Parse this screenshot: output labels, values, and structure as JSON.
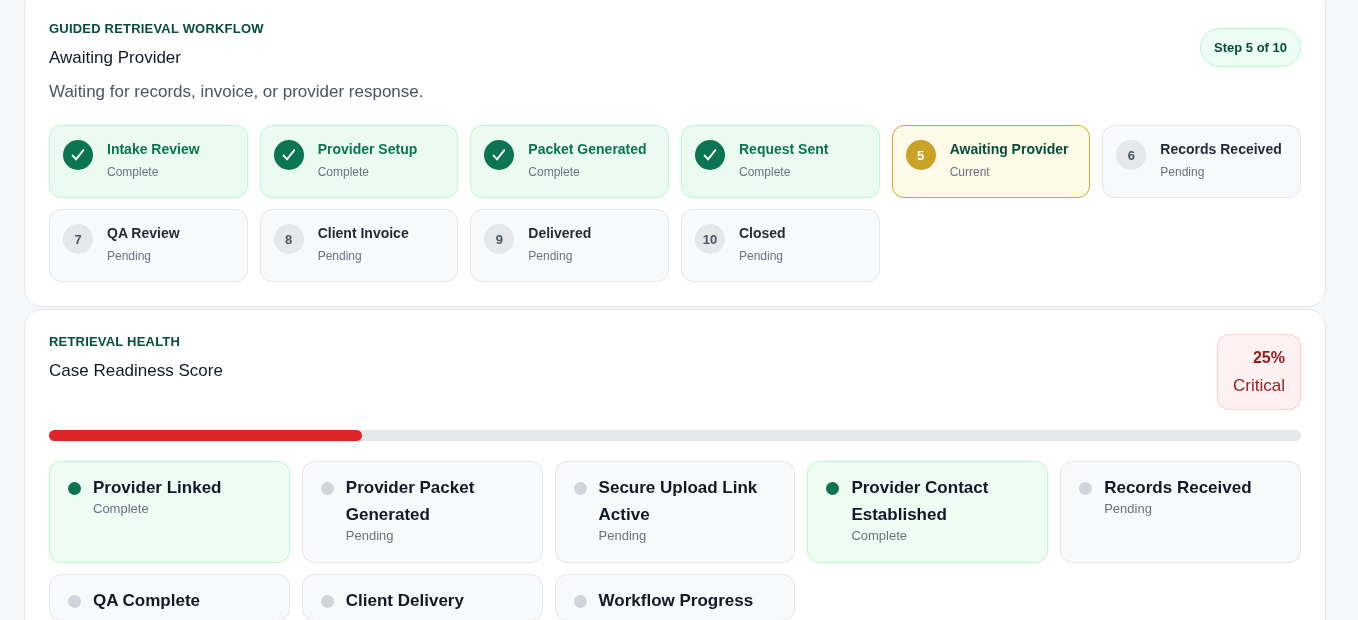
{
  "workflow": {
    "eyebrow": "GUIDED RETRIEVAL WORKFLOW",
    "title": "Awaiting Provider",
    "description": "Waiting for records, invoice, or provider response.",
    "step_badge": "Step 5 of 10",
    "steps": [
      {
        "label": "Intake Review",
        "status": "Complete",
        "kind": "complete"
      },
      {
        "label": "Provider Setup",
        "status": "Complete",
        "kind": "complete"
      },
      {
        "label": "Packet Generated",
        "status": "Complete",
        "kind": "complete"
      },
      {
        "label": "Request Sent",
        "status": "Complete",
        "kind": "complete"
      },
      {
        "number": "5",
        "label": "Awaiting Provider",
        "status": "Current",
        "kind": "current"
      },
      {
        "number": "6",
        "label": "Records Received",
        "status": "Pending",
        "kind": "pending"
      },
      {
        "number": "7",
        "label": "QA Review",
        "status": "Pending",
        "kind": "pending"
      },
      {
        "number": "8",
        "label": "Client Invoice",
        "status": "Pending",
        "kind": "pending"
      },
      {
        "number": "9",
        "label": "Delivered",
        "status": "Pending",
        "kind": "pending"
      },
      {
        "number": "10",
        "label": "Closed",
        "status": "Pending",
        "kind": "pending"
      }
    ]
  },
  "health": {
    "eyebrow": "RETRIEVAL HEALTH",
    "title": "Case Readiness Score",
    "score": "25%",
    "rating": "Critical",
    "level": 0.25,
    "checks": [
      {
        "label": "Provider Linked",
        "status": "Complete",
        "complete": true
      },
      {
        "label": "Provider Packet Generated",
        "status": "Pending",
        "complete": false
      },
      {
        "label": "Secure Upload Link Active",
        "status": "Pending",
        "complete": false
      },
      {
        "label": "Provider Contact Established",
        "status": "Complete",
        "complete": true
      },
      {
        "label": "Records Received",
        "status": "Pending",
        "complete": false
      },
      {
        "label": "QA Complete",
        "complete": false
      },
      {
        "label": "Client Delivery",
        "complete": false
      },
      {
        "label": "Workflow Progress",
        "complete": false
      }
    ]
  }
}
